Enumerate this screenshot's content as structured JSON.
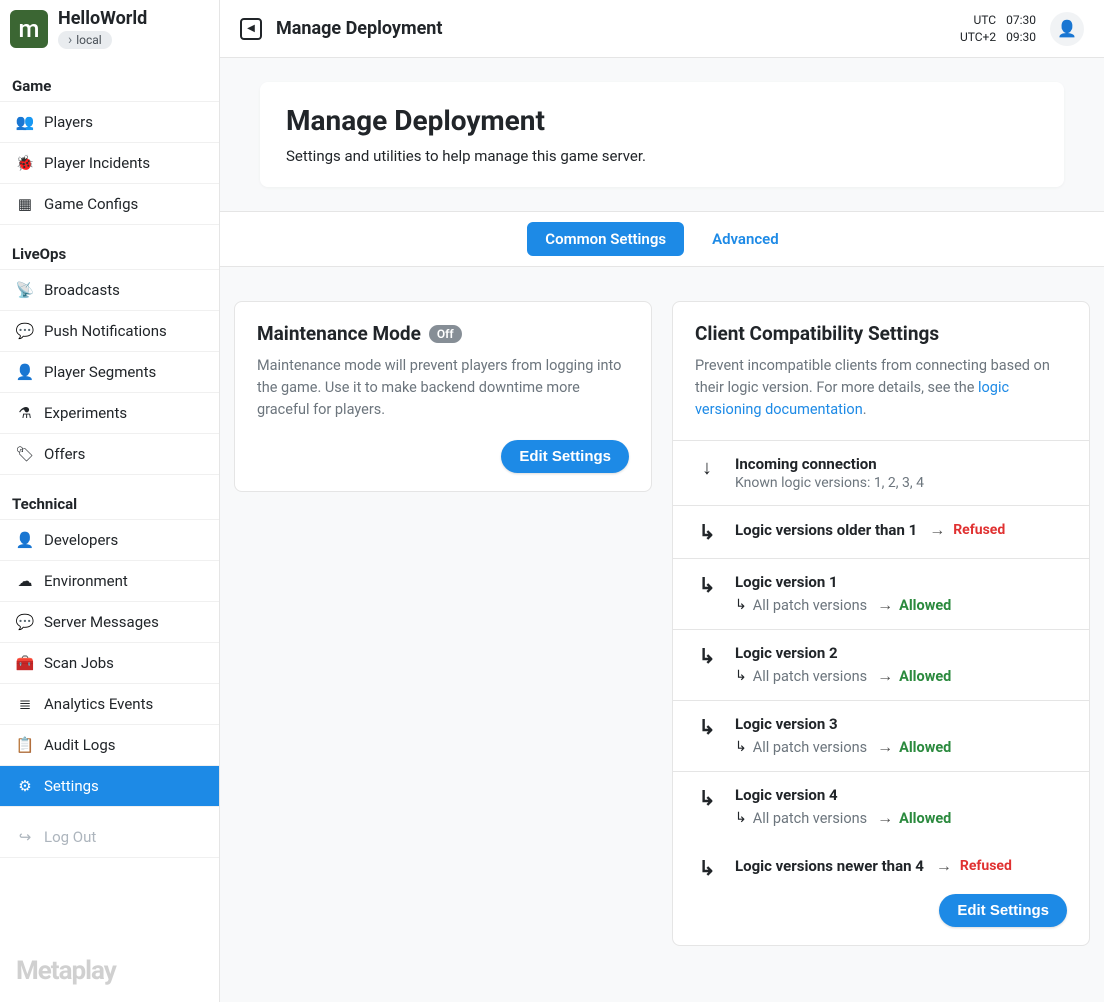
{
  "app": {
    "name": "HelloWorld",
    "env": "local"
  },
  "sidebar": {
    "sections": [
      {
        "title": "Game",
        "items": [
          {
            "label": "Players",
            "icon": "👥"
          },
          {
            "label": "Player Incidents",
            "icon": "🐞"
          },
          {
            "label": "Game Configs",
            "icon": "▦"
          }
        ]
      },
      {
        "title": "LiveOps",
        "items": [
          {
            "label": "Broadcasts",
            "icon": "📡"
          },
          {
            "label": "Push Notifications",
            "icon": "💬"
          },
          {
            "label": "Player Segments",
            "icon": "👤"
          },
          {
            "label": "Experiments",
            "icon": "⚗"
          },
          {
            "label": "Offers",
            "icon": "🏷"
          }
        ]
      },
      {
        "title": "Technical",
        "items": [
          {
            "label": "Developers",
            "icon": "👤"
          },
          {
            "label": "Environment",
            "icon": "☁"
          },
          {
            "label": "Server Messages",
            "icon": "💬"
          },
          {
            "label": "Scan Jobs",
            "icon": "🧰"
          },
          {
            "label": "Analytics Events",
            "icon": "≣"
          },
          {
            "label": "Audit Logs",
            "icon": "📋"
          },
          {
            "label": "Settings",
            "icon": "⚙",
            "active": true
          }
        ]
      }
    ],
    "logout": "Log Out",
    "footer_brand": "Metaplay"
  },
  "topbar": {
    "title": "Manage Deployment",
    "times": [
      {
        "zone": "UTC",
        "time": "07:30"
      },
      {
        "zone": "UTC+2",
        "time": "09:30"
      }
    ]
  },
  "hero": {
    "title": "Manage Deployment",
    "desc": "Settings and utilities to help manage this game server."
  },
  "tabs": [
    {
      "label": "Common Settings",
      "active": true
    },
    {
      "label": "Advanced",
      "active": false
    }
  ],
  "maintenance": {
    "title": "Maintenance Mode",
    "badge": "Off",
    "desc": "Maintenance mode will prevent players from logging into the game. Use it to make backend downtime more graceful for players.",
    "button": "Edit Settings"
  },
  "compat": {
    "title": "Client Compatibility Settings",
    "desc": "Prevent incompatible clients from connecting based on their logic version. For more details, see the ",
    "link": "logic versioning documentation",
    "incoming": {
      "title": "Incoming connection",
      "sub": "Known logic versions: 1, 2, 3, 4"
    },
    "older": {
      "title": "Logic versions older than 1",
      "status": "Refused"
    },
    "versions": [
      {
        "title": "Logic version 1",
        "patch": "All patch versions",
        "status": "Allowed"
      },
      {
        "title": "Logic version 2",
        "patch": "All patch versions",
        "status": "Allowed"
      },
      {
        "title": "Logic version 3",
        "patch": "All patch versions",
        "status": "Allowed"
      },
      {
        "title": "Logic version 4",
        "patch": "All patch versions",
        "status": "Allowed"
      }
    ],
    "newer": {
      "title": "Logic versions newer than 4",
      "status": "Refused"
    },
    "button": "Edit Settings"
  }
}
